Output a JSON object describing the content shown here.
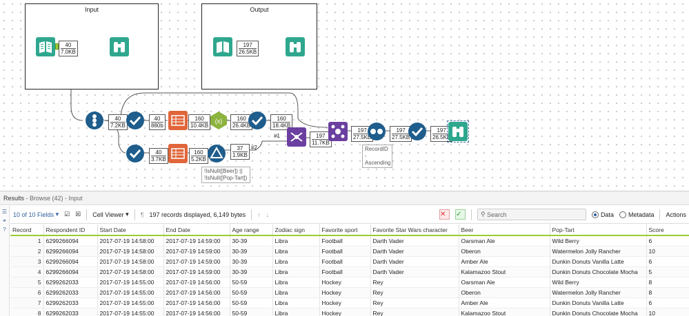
{
  "containers": [
    {
      "title": "Input"
    },
    {
      "title": "Output"
    }
  ],
  "badges": {
    "input_browse": [
      "40",
      "7.0KB"
    ],
    "output_browse": [
      "197",
      "26.5KB"
    ],
    "b1": [
      "40",
      "7.2KB"
    ],
    "b2": [
      "40",
      "880b"
    ],
    "b3": [
      "160",
      "10.4KB"
    ],
    "b4": [
      "160",
      "26.4KB"
    ],
    "b5": [
      "160",
      "18.4KB"
    ],
    "b6": [
      "40",
      "3.7KB"
    ],
    "b7": [
      "160",
      "5.2KB"
    ],
    "b8": [
      "37",
      "1.9KB"
    ],
    "b9": [
      "197",
      "11.7KB"
    ],
    "b10": [
      "197",
      "27.5KB"
    ],
    "b11": [
      "197",
      "27.5KB"
    ],
    "b12": [
      "197",
      "26.5KB"
    ]
  },
  "annotations": {
    "filter": "!IsNull([Beer]) || !IsNull([Pop-Tart])",
    "sort": "RecordID - Ascending"
  },
  "port_labels": {
    "p1": "#1",
    "p2": "#2"
  },
  "results": {
    "title": "Results",
    "subtitle": "- Browse (42) - Input",
    "fields_selector": "10 of 10 Fields",
    "cell_viewer": "Cell Viewer",
    "records_info": "197 records displayed, 6,149 bytes",
    "search_placeholder": "Search",
    "data_label": "Data",
    "metadata_label": "Metadata",
    "actions_label": "Actions"
  },
  "table": {
    "headers": [
      "Record",
      "Respondent ID",
      "Start Date",
      "End Date",
      "Age range",
      "Zodiac sign",
      "Favorite sport",
      "Favorite Star Wars character",
      "Beer",
      "Pop-Tart",
      "Score"
    ],
    "rows": [
      [
        "1",
        "6299266094",
        "2017-07-19 14:58:00",
        "2017-07-19 14:59:00",
        "30-39",
        "Libra",
        "Football",
        "Darth Vader",
        "Oarsman Ale",
        "Wild Berry",
        "6"
      ],
      [
        "2",
        "6299266094",
        "2017-07-19 14:58:00",
        "2017-07-19 14:59:00",
        "30-39",
        "Libra",
        "Football",
        "Darth Vader",
        "Oberon",
        "Watermelon Jolly Rancher",
        "10"
      ],
      [
        "3",
        "6299266094",
        "2017-07-19 14:58:00",
        "2017-07-19 14:59:00",
        "30-39",
        "Libra",
        "Football",
        "Darth Vader",
        "Amber Ale",
        "Dunkin Donuts Vanilla Latte",
        "6"
      ],
      [
        "4",
        "6299266094",
        "2017-07-19 14:58:00",
        "2017-07-19 14:59:00",
        "30-39",
        "Libra",
        "Football",
        "Darth Vader",
        "Kalamazoo Stout",
        "Dunkin Donuts Chocolate Mocha",
        "5"
      ],
      [
        "5",
        "6299262033",
        "2017-07-19 14:55:00",
        "2017-07-19 14:56:00",
        "50-59",
        "Libra",
        "Hockey",
        "Rey",
        "Oarsman Ale",
        "Wild Berry",
        "8"
      ],
      [
        "6",
        "6299262033",
        "2017-07-19 14:55:00",
        "2017-07-19 14:56:00",
        "50-59",
        "Libra",
        "Hockey",
        "Rey",
        "Oberon",
        "Watermelon Jolly Rancher",
        "8"
      ],
      [
        "7",
        "6299262033",
        "2017-07-19 14:55:00",
        "2017-07-19 14:56:00",
        "50-59",
        "Libra",
        "Hockey",
        "Rey",
        "Amber Ale",
        "Dunkin Donuts Vanilla Latte",
        "6"
      ],
      [
        "8",
        "6299262033",
        "2017-07-19 14:55:00",
        "2017-07-19 14:56:00",
        "50-59",
        "Libra",
        "Hockey",
        "Rey",
        "Kalamazoo Stout",
        "Dunkin Donuts Chocolate Mocha",
        "10"
      ]
    ]
  },
  "icons": {
    "input": "book-input-icon",
    "browse": "binoculars-icon",
    "select": "checkmark-select-icon",
    "transpose": "table-transpose-icon",
    "formula": "hexagon-formula-icon",
    "filter": "triangle-filter-icon",
    "union": "union-icon",
    "sort": "sort-dots-icon",
    "join": "join-icon"
  }
}
